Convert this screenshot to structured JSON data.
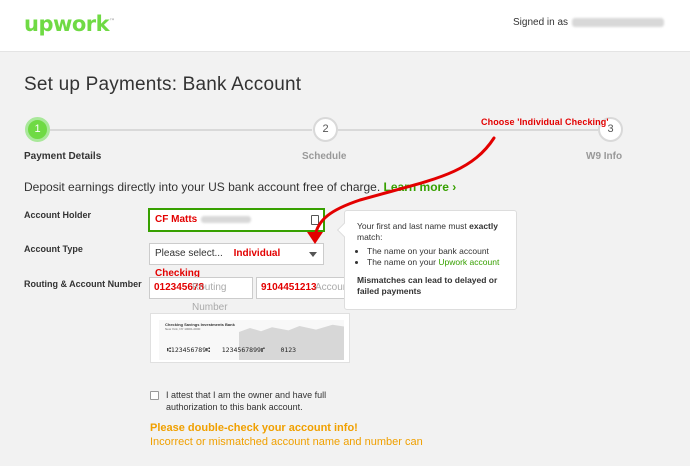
{
  "header": {
    "logo_text": "upwork",
    "logo_tm": "™",
    "signed_in_label": "Signed in as"
  },
  "page": {
    "title": "Set up Payments: Bank Account"
  },
  "steps": [
    {
      "number": "1",
      "label": "Payment Details",
      "active": true
    },
    {
      "number": "2",
      "label": "Schedule",
      "active": false
    },
    {
      "number": "3",
      "label": "W9 Info",
      "active": false
    }
  ],
  "intro": {
    "text": "Deposit earnings directly into your US bank account free of charge.",
    "link": "Learn more ›"
  },
  "form": {
    "account_holder_label": "Account Holder",
    "account_holder_value": "CF Matts",
    "account_type_label": "Account Type",
    "account_type_value": "Please select...",
    "routing_label": "Routing & Account Number",
    "routing_placeholder": "Routing Number",
    "routing_annotation": "012345678",
    "account_placeholder": "Account Number",
    "account_annotation": "9104451213"
  },
  "tooltip": {
    "line1": "Your first and last name must",
    "line1_bold": "exactly",
    "line2": "match:",
    "bullet1": "The name on your bank account",
    "bullet2_prefix": "The name on your",
    "bullet2_link": "Upwork",
    "bullet2_suffix": "account",
    "warning": "Mismatches can lead to delayed or failed payments"
  },
  "check_image": {
    "bank_name": "Checking Savings Investments Bank",
    "bank_address": "New York, NY 10001-0000",
    "micr_line": "⑆123456789⑆   1234567899⑈    0123"
  },
  "attest": {
    "text": "I attest that I am the owner and have full authorization to this bank account."
  },
  "warnings": {
    "title": "Please double-check your account info!",
    "body": "Incorrect or mismatched account name and number can"
  },
  "annotations": {
    "choose_text": "Choose 'Individual Checking'",
    "select_text": "Individual Checking",
    "color": "#e30000"
  },
  "colors": {
    "brand": "#6fda44",
    "link": "#37a000",
    "warning": "#f0a000"
  }
}
